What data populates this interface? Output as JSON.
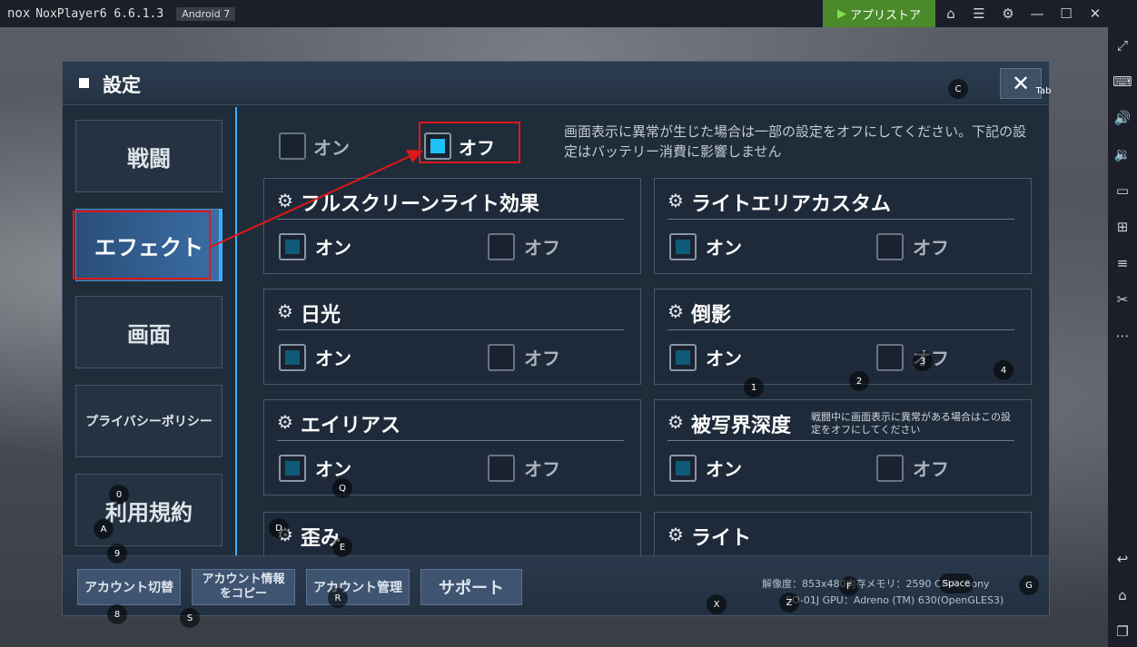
{
  "titlebar": {
    "logo": "nox",
    "app_title": "NoxPlayer6 6.6.1.3",
    "android": "Android 7",
    "appstore_label": "アプリストア",
    "icons": [
      "shirt-icon",
      "menu-icon",
      "gear-icon",
      "minimize-icon",
      "maximize-icon",
      "close-icon"
    ]
  },
  "right_sidebar": {
    "icons": [
      "fullscreen-icon",
      "keyboard-icon",
      "volume-up-icon",
      "volume-down-icon",
      "screen-icon",
      "apk-icon",
      "multi-instance-icon",
      "scissors-icon",
      "more-icon",
      "back-icon",
      "home-icon",
      "recent-apps-icon"
    ]
  },
  "dialog": {
    "title": "設定",
    "close_key": "Tab",
    "nav": [
      {
        "label": "戦闘"
      },
      {
        "label": "エフェクト"
      },
      {
        "label": "画面"
      },
      {
        "label": "プライバシーポリシー"
      },
      {
        "label": "利用規約"
      }
    ],
    "master_toggle": {
      "on_label": "オン",
      "off_label": "オフ",
      "selected": "オフ"
    },
    "notice": "画面表示に異常が生じた場合は一部の設定をオフにしてください。下記の設定はバッテリー消費に影響しません",
    "cards": [
      {
        "title": "フルスクリーンライト効果",
        "on": "オン",
        "off": "オフ",
        "selected": "オン"
      },
      {
        "title": "ライトエリアカスタム",
        "on": "オン",
        "off": "オフ",
        "selected": "オン"
      },
      {
        "title": "日光",
        "on": "オン",
        "off": "オフ",
        "selected": "オン"
      },
      {
        "title": "倒影",
        "on": "オン",
        "off": "オフ",
        "selected": "オン"
      },
      {
        "title": "エイリアス",
        "on": "オン",
        "off": "オフ",
        "selected": "オン"
      },
      {
        "title": "被写界深度",
        "note": "戦闘中に画面表示に異常がある場合はこの設定をオフにしてください",
        "on": "オン",
        "off": "オフ",
        "selected": "オン"
      },
      {
        "title": "歪み"
      },
      {
        "title": "ライト"
      }
    ],
    "footer": {
      "buttons": [
        "アカウント切替",
        "アカウント情報をコピー",
        "アカウント管理",
        "サポート"
      ],
      "sysinfo_line1": "解像度：853x480内存メモリ：2590 CPU：Sony",
      "sysinfo_line2": "SO-01J GPU：Adreno (TM) 630(OpenGLES3)"
    }
  },
  "keymap_labels": [
    "C",
    "Tab",
    "1",
    "2",
    "3",
    "4",
    "Q",
    "0",
    "A",
    "9",
    "D",
    "E",
    "8",
    "S",
    "R",
    "X",
    "Z",
    "F",
    "Space",
    "G"
  ]
}
